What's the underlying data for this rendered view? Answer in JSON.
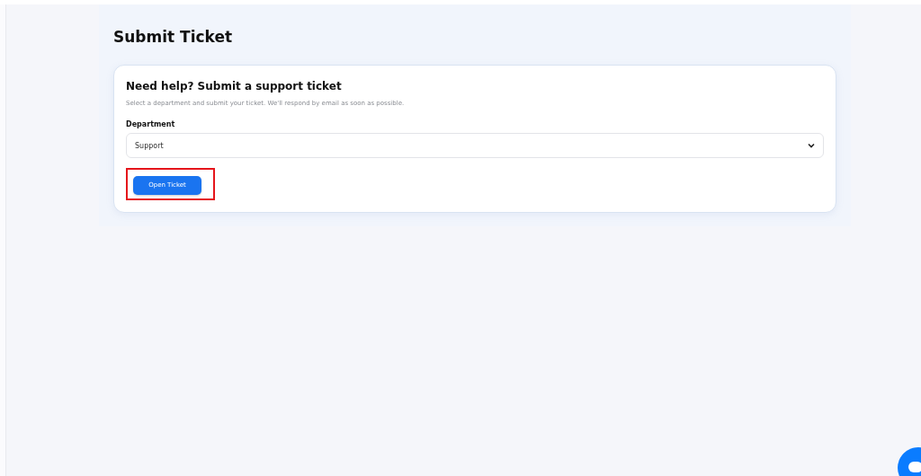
{
  "page_title": "Submit Ticket",
  "card": {
    "heading": "Need help? Submit a support ticket",
    "description": "Select a department and submit your ticket. We'll respond by email as soon as possible.",
    "field_label": "Department",
    "select_value": "Support",
    "button": "Open Ticket"
  }
}
